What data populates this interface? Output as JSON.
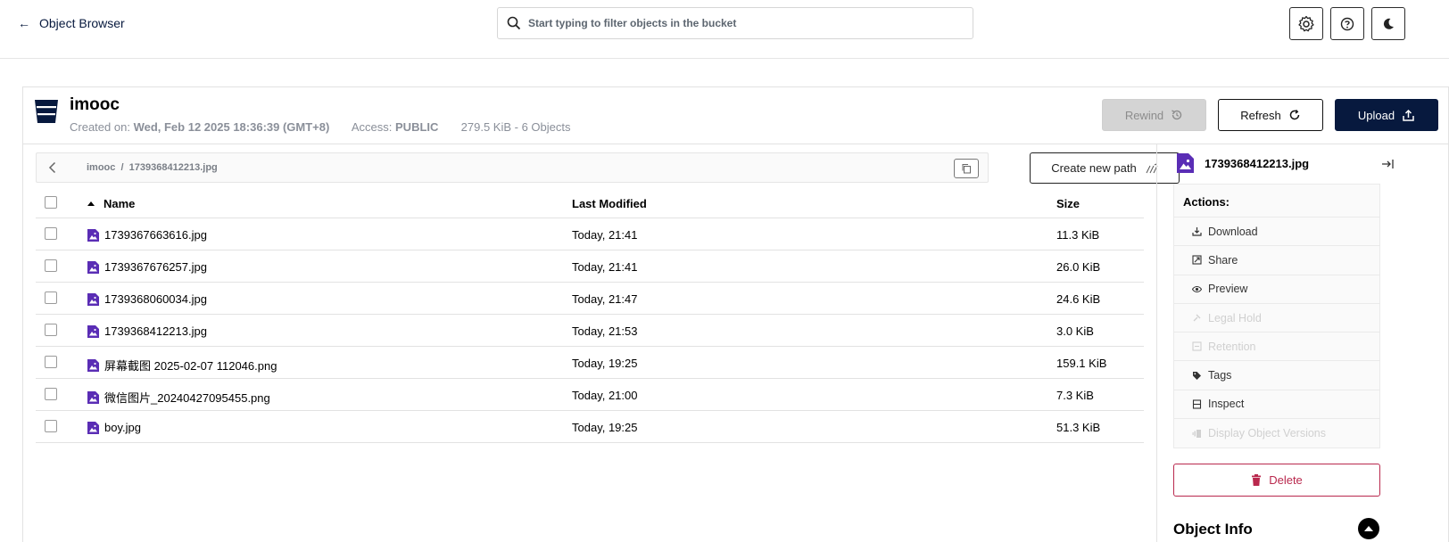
{
  "header": {
    "back_label": "Object Browser",
    "search_placeholder": "Start typing to filter objects in the bucket"
  },
  "bucket": {
    "name": "imooc",
    "created_label": "Created on:",
    "created_value": "Wed, Feb 12 2025 18:36:39 (GMT+8)",
    "access_label": "Access:",
    "access_value": "PUBLIC",
    "usage": "279.5 KiB - 6 Objects"
  },
  "toolbar": {
    "rewind_label": "Rewind",
    "refresh_label": "Refresh",
    "upload_label": "Upload",
    "new_path_label": "Create new path"
  },
  "breadcrumb": {
    "path": "imooc  /  1739368412213.jpg"
  },
  "table": {
    "columns": {
      "name": "Name",
      "modified": "Last Modified",
      "size": "Size"
    },
    "rows": [
      {
        "name": "1739367663616.jpg",
        "modified": "Today, 21:41",
        "size": "11.3 KiB"
      },
      {
        "name": "1739367676257.jpg",
        "modified": "Today, 21:41",
        "size": "26.0 KiB"
      },
      {
        "name": "1739368060034.jpg",
        "modified": "Today, 21:47",
        "size": "24.6 KiB"
      },
      {
        "name": "1739368412213.jpg",
        "modified": "Today, 21:53",
        "size": "3.0 KiB"
      },
      {
        "name": "屏幕截图 2025-02-07 112046.png",
        "modified": "Today, 19:25",
        "size": "159.1 KiB"
      },
      {
        "name": "微信图片_20240427095455.png",
        "modified": "Today, 21:00",
        "size": "7.3 KiB"
      },
      {
        "name": "boy.jpg",
        "modified": "Today, 19:25",
        "size": "51.3 KiB"
      }
    ]
  },
  "details": {
    "file_name": "1739368412213.jpg",
    "actions_title": "Actions:",
    "actions": [
      {
        "label": "Download",
        "enabled": true
      },
      {
        "label": "Share",
        "enabled": true
      },
      {
        "label": "Preview",
        "enabled": true
      },
      {
        "label": "Legal Hold",
        "enabled": false
      },
      {
        "label": "Retention",
        "enabled": false
      },
      {
        "label": "Tags",
        "enabled": true
      },
      {
        "label": "Inspect",
        "enabled": true
      },
      {
        "label": "Display Object Versions",
        "enabled": false
      }
    ],
    "delete_label": "Delete",
    "object_info_title": "Object Info"
  },
  "colors": {
    "primary": "#07193e",
    "file_icon": "#5a2db5",
    "danger": "#b9284d"
  }
}
